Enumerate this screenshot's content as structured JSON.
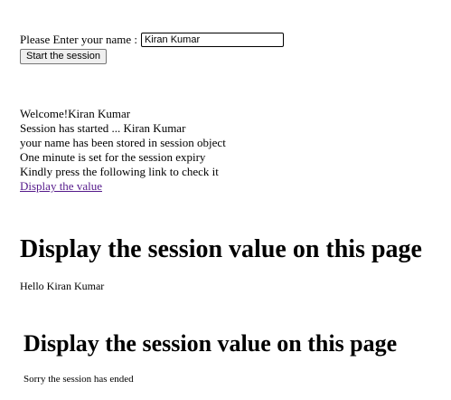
{
  "form": {
    "name_label": "Please Enter your name :",
    "name_value": "Kiran Kumar",
    "start_button": "Start the session"
  },
  "status": {
    "lines": [
      "Welcome!Kiran Kumar",
      "Session has started ... Kiran Kumar",
      "your name has been stored in session object",
      "One minute is set for the session expiry",
      "Kindly press the following link to check it"
    ],
    "link_text": "Display the value"
  },
  "display_section": {
    "heading": "Display the session value on this page",
    "message": "Hello Kiran Kumar"
  },
  "expired_section": {
    "heading": "Display the session value on this page",
    "message": "Sorry the session has ended"
  },
  "colors": {
    "visited_link": "#551a8b",
    "button_bg": "#efefef"
  }
}
